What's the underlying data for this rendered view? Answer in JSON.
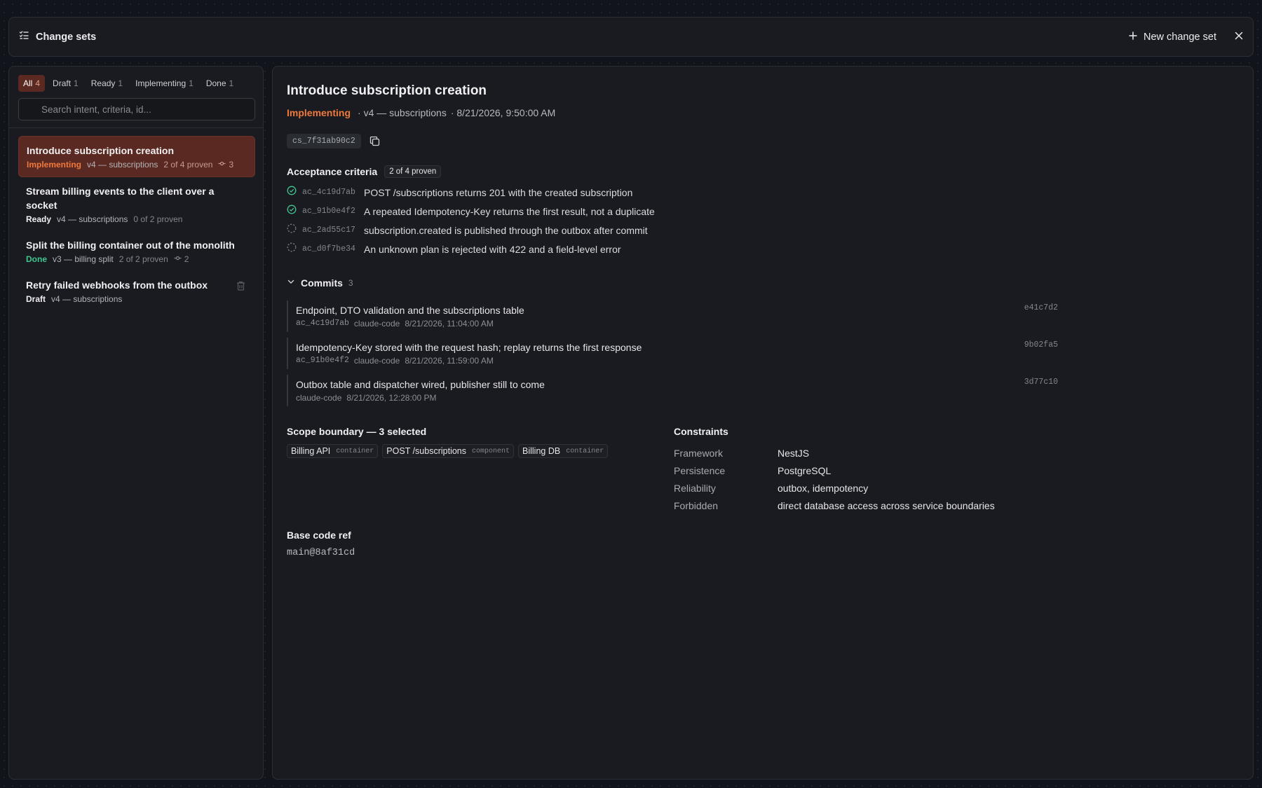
{
  "header": {
    "title": "Change sets",
    "new_button_label": "New change set"
  },
  "sidebar": {
    "filters": [
      {
        "label": "All",
        "count": "4"
      },
      {
        "label": "Draft",
        "count": "1"
      },
      {
        "label": "Ready",
        "count": "1"
      },
      {
        "label": "Implementing",
        "count": "1"
      },
      {
        "label": "Done",
        "count": "1"
      }
    ],
    "search_placeholder": "Search intent, criteria, id...",
    "items": [
      {
        "title": "Introduce subscription creation",
        "status": "Implementing",
        "version": "v4 — subscriptions",
        "proven": "2 of 4 proven",
        "commits": "3"
      },
      {
        "title": "Stream billing events to the client over a socket",
        "status": "Ready",
        "version": "v4 — subscriptions",
        "proven": "0 of 2 proven"
      },
      {
        "title": "Split the billing container out of the monolith",
        "status": "Done",
        "version": "v3 — billing split",
        "proven": "2 of 2 proven",
        "commits": "2"
      },
      {
        "title": "Retry failed webhooks from the outbox",
        "status": "Draft",
        "version": "v4 — subscriptions"
      }
    ]
  },
  "detail": {
    "title": "Introduce subscription creation",
    "status": "Implementing",
    "version": "· v4 — subscriptions",
    "timestamp": "· 8/21/2026, 9:50:00 AM",
    "id": "cs_7f31ab90c2",
    "acceptance": {
      "heading": "Acceptance criteria",
      "badge": "2 of 4 proven",
      "items": [
        {
          "id": "ac_4c19d7ab",
          "text": "POST /subscriptions returns 201 with the created subscription",
          "proven": true
        },
        {
          "id": "ac_91b0e4f2",
          "text": "A repeated Idempotency-Key returns the first result, not a duplicate",
          "proven": true
        },
        {
          "id": "ac_2ad55c17",
          "text": "subscription.created is published through the outbox after commit",
          "proven": false
        },
        {
          "id": "ac_d0f7be34",
          "text": "An unknown plan is rejected with 422 and a field-level error",
          "proven": false
        }
      ]
    },
    "commits": {
      "heading": "Commits",
      "count": "3",
      "items": [
        {
          "message": "Endpoint, DTO validation and the subscriptions table",
          "ac": "ac_4c19d7ab",
          "author": "claude-code",
          "time": "8/21/2026, 11:04:00 AM",
          "sha": "e41c7d2"
        },
        {
          "message": "Idempotency-Key stored with the request hash; replay returns the first response",
          "ac": "ac_91b0e4f2",
          "author": "claude-code",
          "time": "8/21/2026, 11:59:00 AM",
          "sha": "9b02fa5"
        },
        {
          "message": "Outbox table and dispatcher wired, publisher still to come",
          "ac": "",
          "author": "claude-code",
          "time": "8/21/2026, 12:28:00 PM",
          "sha": "3d77c10"
        }
      ]
    },
    "scope": {
      "heading": "Scope boundary — 3 selected",
      "tags": [
        {
          "name": "Billing API",
          "kind": "container"
        },
        {
          "name": "POST /subscriptions",
          "kind": "component"
        },
        {
          "name": "Billing DB",
          "kind": "container"
        }
      ]
    },
    "constraints": {
      "heading": "Constraints",
      "rows": [
        {
          "key": "Framework",
          "value": "NestJS"
        },
        {
          "key": "Persistence",
          "value": "PostgreSQL"
        },
        {
          "key": "Reliability",
          "value": "outbox, idempotency"
        },
        {
          "key": "Forbidden",
          "value": "direct database access across service boundaries"
        }
      ]
    },
    "base_ref": {
      "heading": "Base code ref",
      "value": "main@8af31cd"
    }
  },
  "colors": {
    "accent": "#ef7a3c",
    "selected_bg": "#5a2a22",
    "success": "#3ec78e",
    "background": "#11141a",
    "panel": "#1a1b20"
  },
  "icons": [
    "checklist-icon",
    "plus-icon",
    "close-icon",
    "search-icon",
    "commit-icon",
    "trash-icon",
    "copy-icon",
    "check-circle-icon",
    "pending-circle-icon",
    "chevron-down-icon"
  ]
}
